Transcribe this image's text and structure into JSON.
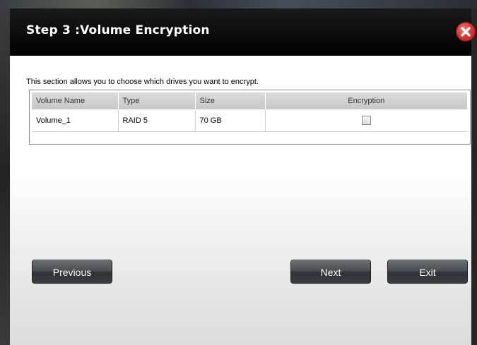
{
  "dialog": {
    "title": "Step 3 :Volume Encryption",
    "intro_text": "This section allows you to choose which drives you want to encrypt."
  },
  "table": {
    "headers": [
      "Volume Name",
      "Type",
      "Size",
      "Encryption"
    ],
    "rows": [
      {
        "volume_name": "Volume_1",
        "type": "RAID 5",
        "size": "70 GB",
        "encryption_checked": false
      }
    ]
  },
  "buttons": {
    "previous": "Previous",
    "next": "Next",
    "exit": "Exit"
  },
  "icons": {
    "close": "close-icon"
  },
  "colors": {
    "titlebar": "#000000",
    "close_button": "#d93a3a",
    "button_dark": "#3a3e42"
  }
}
